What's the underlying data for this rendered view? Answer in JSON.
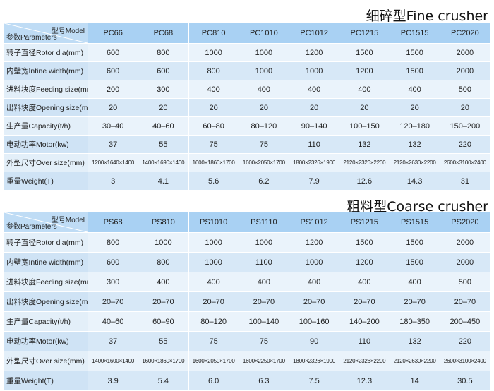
{
  "fine": {
    "title": "细碎型Fine crusher",
    "corner_model": "型号Model",
    "corner_params": "参数Parameters",
    "models": [
      "PC66",
      "PC68",
      "PC810",
      "PC1010",
      "PC1012",
      "PC1215",
      "PC1515",
      "PC2020"
    ],
    "rows": [
      {
        "label": "转子直径Rotor dia(mm)",
        "values": [
          "600",
          "800",
          "1000",
          "1000",
          "1200",
          "1500",
          "1500",
          "2000"
        ]
      },
      {
        "label": "内壁宽Intine width(mm)",
        "values": [
          "600",
          "600",
          "800",
          "1000",
          "1000",
          "1200",
          "1500",
          "2000"
        ]
      },
      {
        "label": "进料块度Feeding size(mm)",
        "values": [
          "200",
          "300",
          "400",
          "400",
          "400",
          "400",
          "400",
          "500"
        ]
      },
      {
        "label": "出料块度Opening size(mm)",
        "values": [
          "20",
          "20",
          "20",
          "20",
          "20",
          "20",
          "20",
          "20"
        ]
      },
      {
        "label": "生产量Capacity(t/h)",
        "values": [
          "30–40",
          "40–60",
          "60–80",
          "80–120",
          "90–140",
          "100–150",
          "120–180",
          "150–200"
        ]
      },
      {
        "label": "电动功率Motor(kw)",
        "values": [
          "37",
          "55",
          "75",
          "75",
          "110",
          "132",
          "132",
          "220"
        ]
      },
      {
        "label": "外型尺寸Over size(mm)",
        "values": [
          "1200×1640×1400",
          "1400×1690×1400",
          "1600×1860×1700",
          "1600×2050×1700",
          "1800×2326×1900",
          "2120×2326×2200",
          "2120×2630×2200",
          "2600×3100×2400"
        ]
      },
      {
        "label": "重量Weight(T)",
        "values": [
          "3",
          "4.1",
          "5.6",
          "6.2",
          "7.9",
          "12.6",
          "14.3",
          "31"
        ]
      }
    ]
  },
  "coarse": {
    "title": "粗料型Coarse crusher",
    "corner_model": "型号Model",
    "corner_params": "参数Parameters",
    "models": [
      "PS68",
      "PS810",
      "PS1010",
      "PS1110",
      "PS1012",
      "PS1215",
      "PS1515",
      "PS2020"
    ],
    "rows": [
      {
        "label": "转子直径Rotor dia(mm)",
        "values": [
          "800",
          "1000",
          "1000",
          "1000",
          "1200",
          "1500",
          "1500",
          "2000"
        ]
      },
      {
        "label": "内壁宽Intine width(mm)",
        "values": [
          "600",
          "800",
          "1000",
          "1100",
          "1000",
          "1200",
          "1500",
          "2000"
        ]
      },
      {
        "label": "进料块度Feeding size(mm)",
        "values": [
          "300",
          "400",
          "400",
          "400",
          "400",
          "400",
          "400",
          "500"
        ]
      },
      {
        "label": "出料块度Opening size(mm)",
        "values": [
          "20–70",
          "20–70",
          "20–70",
          "20–70",
          "20–70",
          "20–70",
          "20–70",
          "20–70"
        ]
      },
      {
        "label": "生产量Capacity(t/h)",
        "values": [
          "40–60",
          "60–90",
          "80–120",
          "100–140",
          "100–160",
          "140–200",
          "180–350",
          "200–450"
        ]
      },
      {
        "label": "电动功率Motor(kw)",
        "values": [
          "37",
          "55",
          "75",
          "75",
          "90",
          "110",
          "132",
          "220"
        ]
      },
      {
        "label": "外型尺寸Over size(mm)",
        "values": [
          "1400×1600×1400",
          "1600×1860×1700",
          "1600×2050×1700",
          "1600×2250×1700",
          "1800×2326×1900",
          "2120×2326×2200",
          "2120×2630×2200",
          "2600×3100×2400"
        ]
      },
      {
        "label": "重量Weight(T)",
        "values": [
          "3.9",
          "5.4",
          "6.0",
          "6.3",
          "7.5",
          "12.3",
          "14",
          "30.5"
        ]
      }
    ]
  }
}
